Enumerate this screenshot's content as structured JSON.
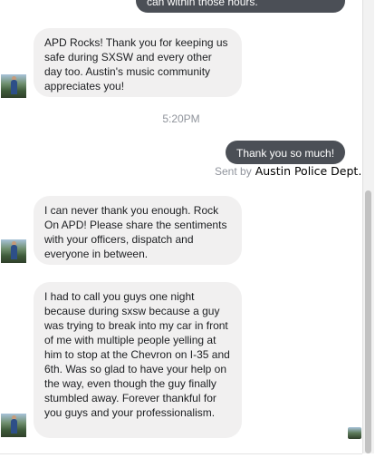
{
  "messages": {
    "top_partial": "can within those hours.",
    "incoming_1": "APD Rocks! Thank you for keeping us safe during SXSW and every other day too. Austin's music community appreciates you!",
    "timestamp": "5:20PM",
    "outgoing_1": "Thank you so much!",
    "sent_by_label": "Sent by",
    "sent_by_name": "Austin Police Dept.",
    "incoming_2": "I can never thank you enough. Rock On APD!  Please share the sentiments with your officers, dispatch and everyone in between.",
    "incoming_3": "I had to call you guys one night because during sxsw because a guy was trying to break into my car in front of me with multiple people yelling at him to stop at the Chevron on I-35 and 6th. Was so glad to have your help on the way, even though the guy finally stumbled away. Forever thankful for you guys and your professionalism."
  },
  "icons": {
    "sender_avatar": "user-avatar-icon",
    "read_receipt": "seen-avatar-icon"
  },
  "colors": {
    "incoming_bubble": "#f1f0f0",
    "outgoing_bubble": "#4b4f56",
    "meta_text": "#90949c"
  }
}
